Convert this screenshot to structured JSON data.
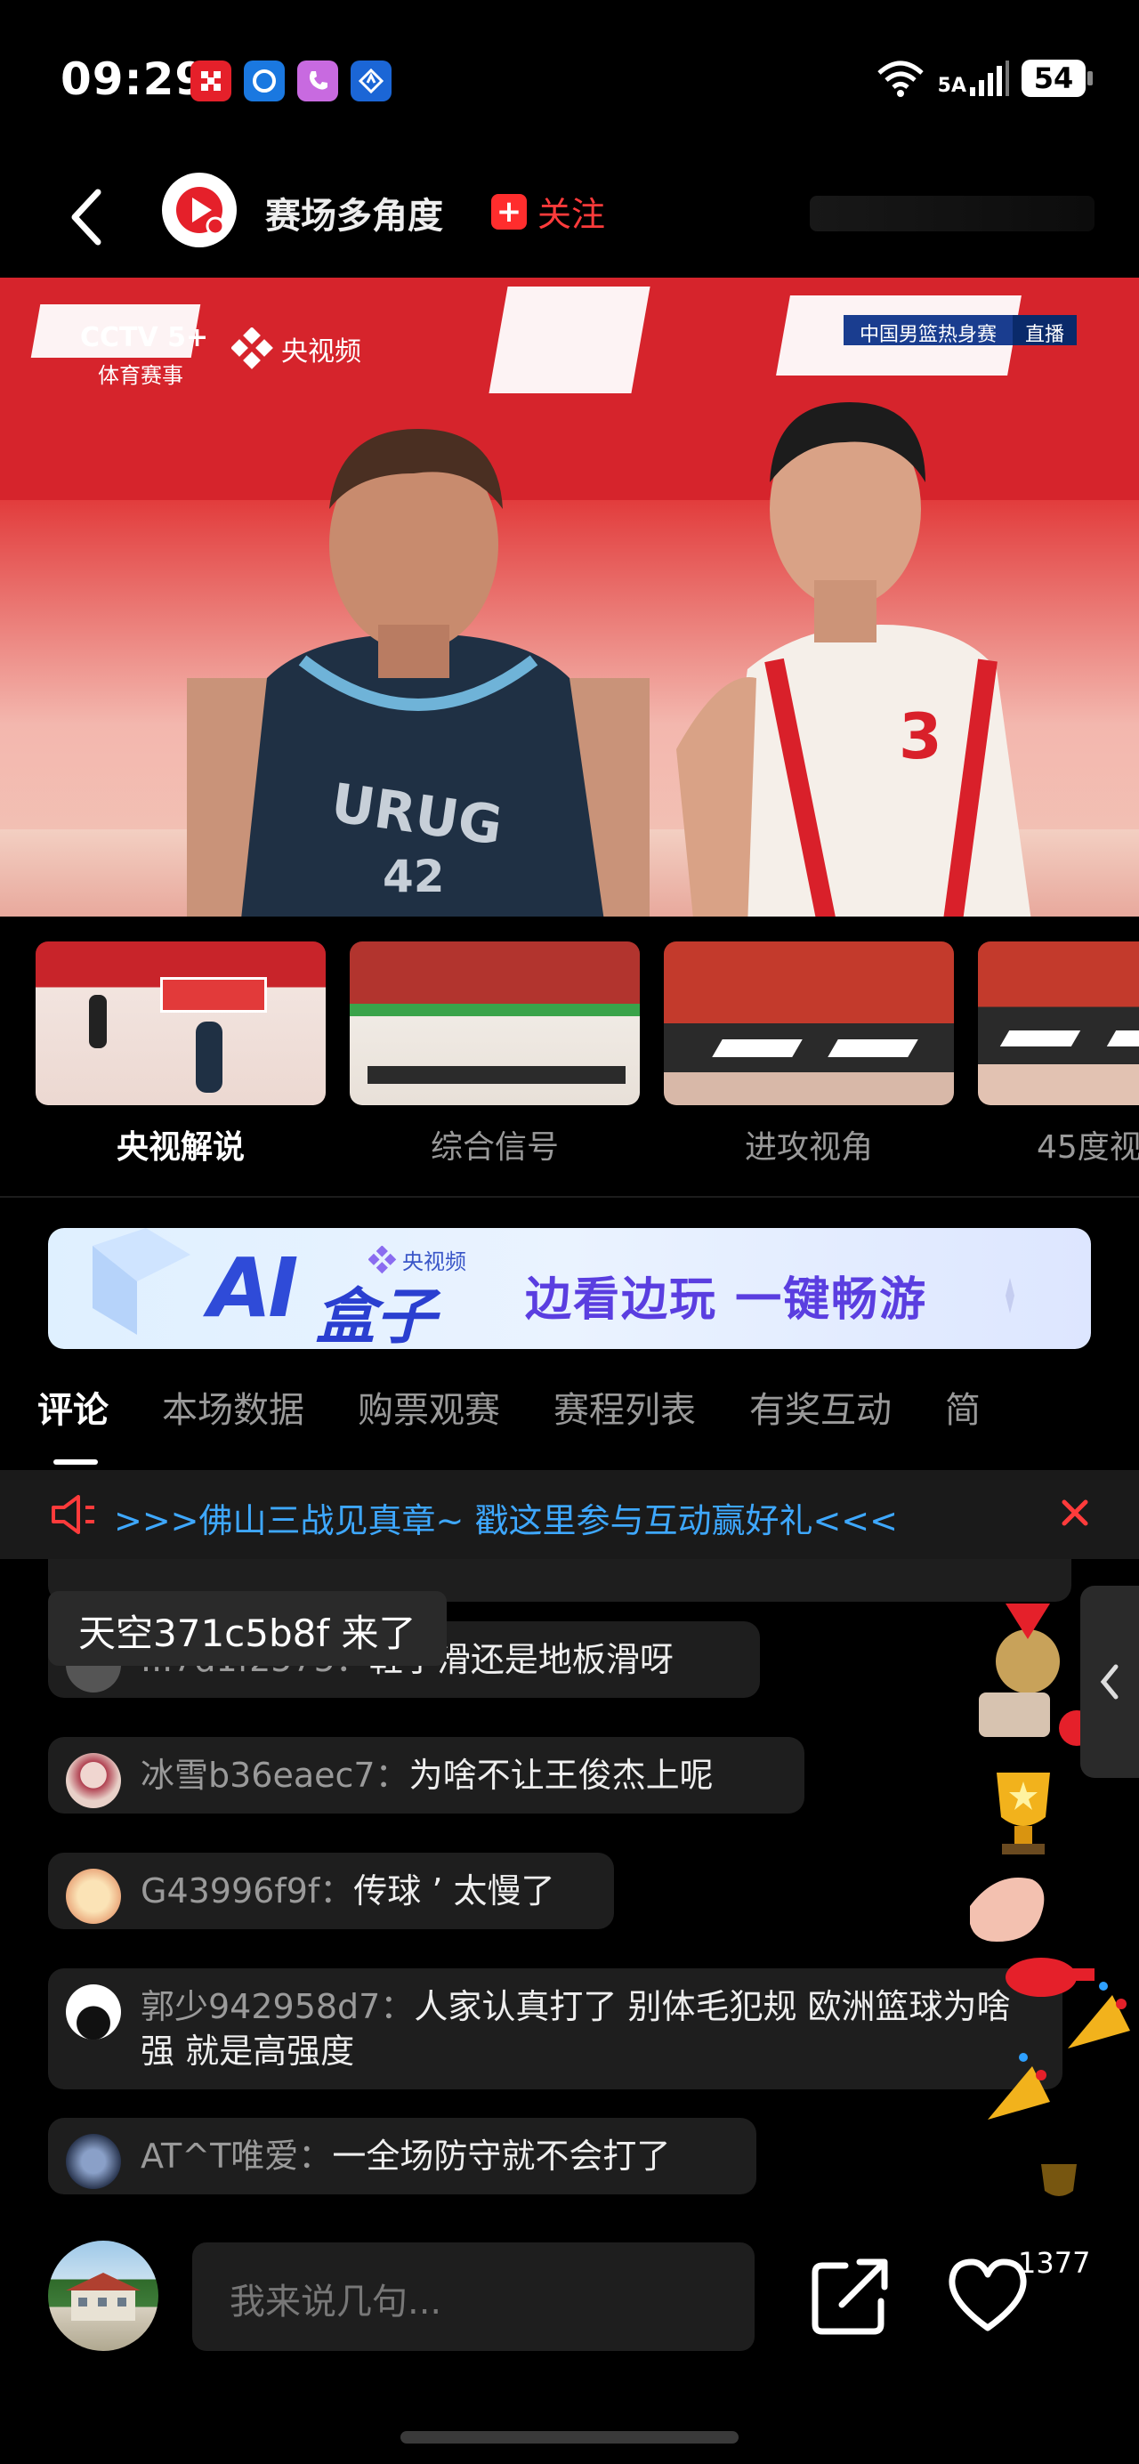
{
  "status_bar": {
    "time": "09:29",
    "network": "5A",
    "battery": "54"
  },
  "header": {
    "channel_name": "赛场多角度",
    "follow_label": "关注"
  },
  "video": {
    "broadcaster": "CCTV 5+",
    "broadcaster_sub": "体育赛事",
    "platform": "央视频",
    "event_name": "中国男篮热身赛",
    "live_state": "直播"
  },
  "angles": [
    {
      "label": "央视解说",
      "active": true
    },
    {
      "label": "综合信号",
      "active": false
    },
    {
      "label": "进攻视角",
      "active": false
    },
    {
      "label": "45度视",
      "active": false
    }
  ],
  "ai_banner": {
    "brand": "央视频",
    "logo_ai": "AI",
    "logo_box": "盒子",
    "slogan": "边看边玩 一键畅游"
  },
  "tabs": [
    {
      "label": "评论",
      "active": true
    },
    {
      "label": "本场数据",
      "active": false
    },
    {
      "label": "购票观赛",
      "active": false
    },
    {
      "label": "赛程列表",
      "active": false
    },
    {
      "label": "有奖互动",
      "active": false
    },
    {
      "label": "简",
      "active": false
    }
  ],
  "notice": {
    "text": ">>>佛山三战见真章~ 戳这里参与互动赢好礼<<<"
  },
  "chat": {
    "join_notice": "天空371c5b8f 来了",
    "messages": [
      {
        "user": "...7d1f2575：",
        "text": "鞋子滑还是地板滑呀"
      },
      {
        "user": "冰雪b36eaec7：",
        "text": "为啥不让王俊杰上呢"
      },
      {
        "user": "G43996f9f：",
        "text": "传球 ’ 太慢了"
      },
      {
        "user": "郭少942958d7：",
        "text": "人家认真打了 别体毛犯规 欧洲篮球为啥强 就是高强度"
      },
      {
        "user": "AT^T唯爱：",
        "text": "一全场防守就不会打了"
      }
    ]
  },
  "bottom_bar": {
    "input_placeholder": "我来说几句...",
    "like_count": "1377"
  },
  "colors": {
    "accent_red": "#ff3b3b",
    "link_blue": "#3ea8ff",
    "background": "#000000"
  }
}
